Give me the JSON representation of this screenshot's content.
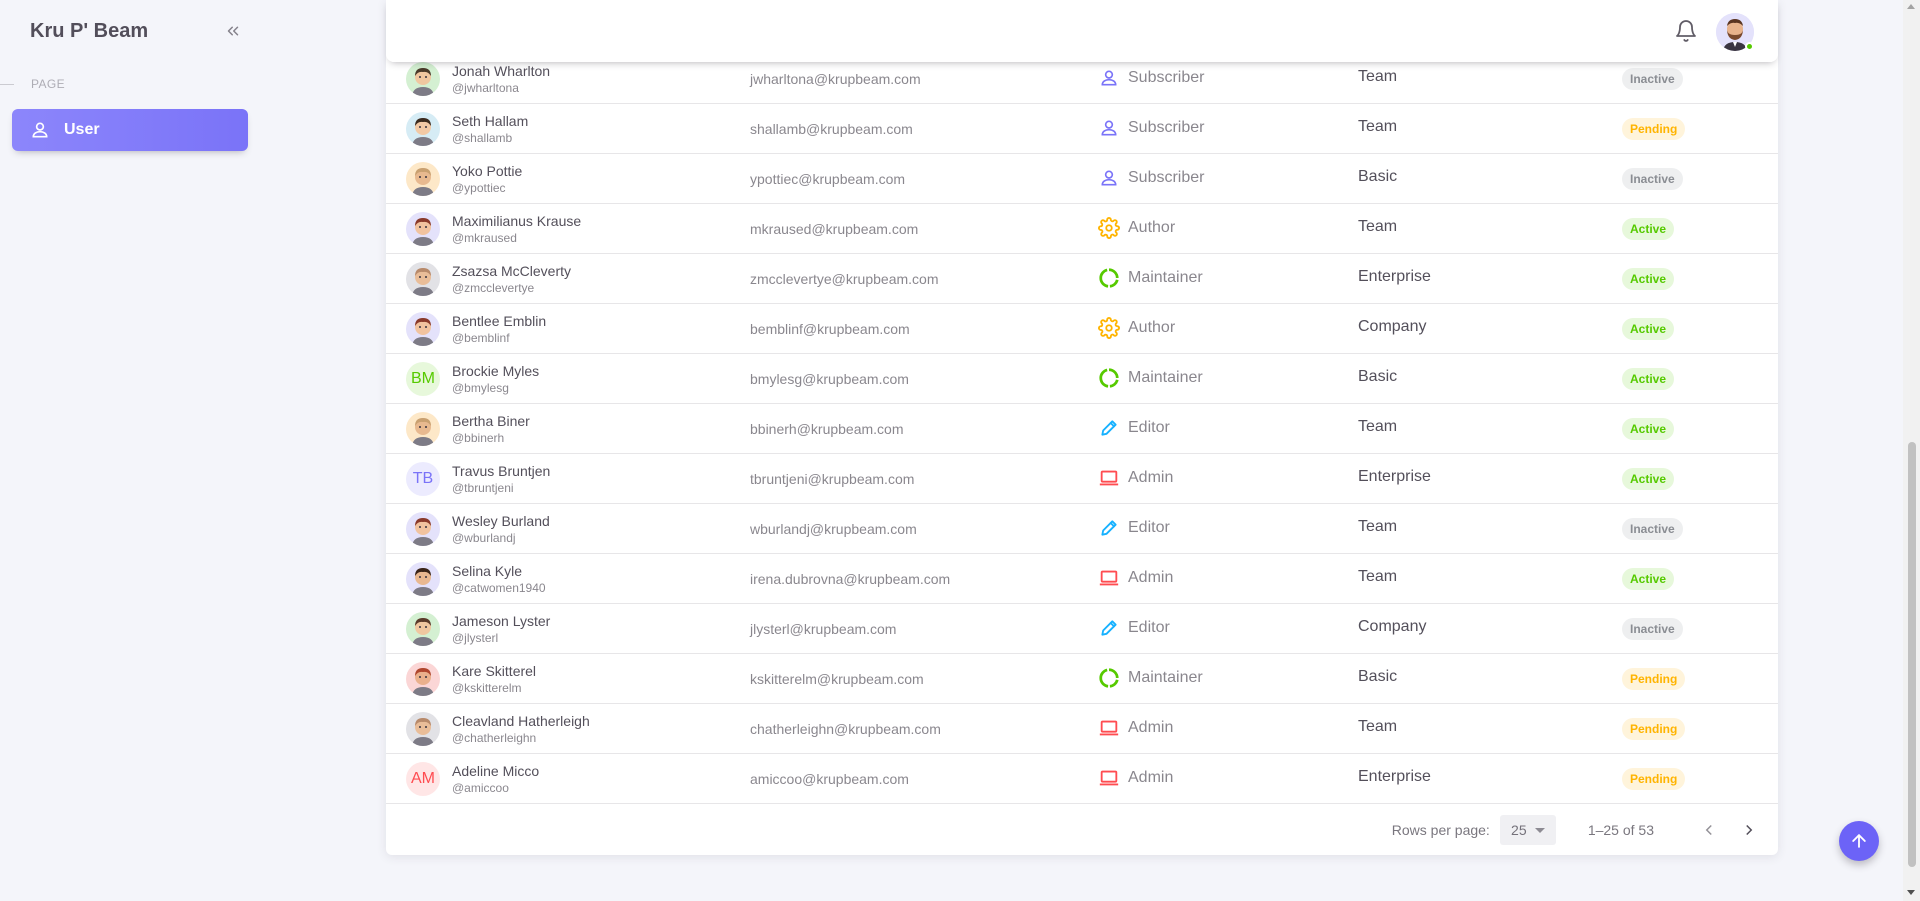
{
  "brand": "Kru P' Beam",
  "sidebar": {
    "section": "PAGE",
    "items": [
      {
        "label": "User",
        "icon": "account-outline-icon"
      }
    ]
  },
  "accent_color": "#7a73f8",
  "users": [
    {
      "name": "Jonah Wharlton",
      "handle": "@jwharltona",
      "email": "jwharltona@krupbeam.com",
      "role": "Subscriber",
      "plan": "Team",
      "status": "Inactive",
      "avatar": "image"
    },
    {
      "name": "Seth Hallam",
      "handle": "@shallamb",
      "email": "shallamb@krupbeam.com",
      "role": "Subscriber",
      "plan": "Team",
      "status": "Pending",
      "avatar": "image"
    },
    {
      "name": "Yoko Pottie",
      "handle": "@ypottiec",
      "email": "ypottiec@krupbeam.com",
      "role": "Subscriber",
      "plan": "Basic",
      "status": "Inactive",
      "avatar": "image"
    },
    {
      "name": "Maximilianus Krause",
      "handle": "@mkraused",
      "email": "mkraused@krupbeam.com",
      "role": "Author",
      "plan": "Team",
      "status": "Active",
      "avatar": "image"
    },
    {
      "name": "Zsazsa McCleverty",
      "handle": "@zmcclevertye",
      "email": "zmcclevertye@krupbeam.com",
      "role": "Maintainer",
      "plan": "Enterprise",
      "status": "Active",
      "avatar": "image"
    },
    {
      "name": "Bentlee Emblin",
      "handle": "@bemblinf",
      "email": "bemblinf@krupbeam.com",
      "role": "Author",
      "plan": "Company",
      "status": "Active",
      "avatar": "image"
    },
    {
      "name": "Brockie Myles",
      "handle": "@bmylesg",
      "email": "bmylesg@krupbeam.com",
      "role": "Maintainer",
      "plan": "Basic",
      "status": "Active",
      "avatar": "BM"
    },
    {
      "name": "Bertha Biner",
      "handle": "@bbinerh",
      "email": "bbinerh@krupbeam.com",
      "role": "Editor",
      "plan": "Team",
      "status": "Active",
      "avatar": "image"
    },
    {
      "name": "Travus Bruntjen",
      "handle": "@tbruntjeni",
      "email": "tbruntjeni@krupbeam.com",
      "role": "Admin",
      "plan": "Enterprise",
      "status": "Active",
      "avatar": "TB"
    },
    {
      "name": "Wesley Burland",
      "handle": "@wburlandj",
      "email": "wburlandj@krupbeam.com",
      "role": "Editor",
      "plan": "Team",
      "status": "Inactive",
      "avatar": "image"
    },
    {
      "name": "Selina Kyle",
      "handle": "@catwomen1940",
      "email": "irena.dubrovna@krupbeam.com",
      "role": "Admin",
      "plan": "Team",
      "status": "Active",
      "avatar": "image"
    },
    {
      "name": "Jameson Lyster",
      "handle": "@jlysterl",
      "email": "jlysterl@krupbeam.com",
      "role": "Editor",
      "plan": "Company",
      "status": "Inactive",
      "avatar": "image"
    },
    {
      "name": "Kare Skitterel",
      "handle": "@kskitterelm",
      "email": "kskitterelm@krupbeam.com",
      "role": "Maintainer",
      "plan": "Basic",
      "status": "Pending",
      "avatar": "image"
    },
    {
      "name": "Cleavland Hatherleigh",
      "handle": "@chatherleighn",
      "email": "chatherleighn@krupbeam.com",
      "role": "Admin",
      "plan": "Team",
      "status": "Pending",
      "avatar": "image"
    },
    {
      "name": "Adeline Micco",
      "handle": "@amiccoo",
      "email": "amiccoo@krupbeam.com",
      "role": "Admin",
      "plan": "Enterprise",
      "status": "Pending",
      "avatar": "AM"
    }
  ],
  "role_colors": {
    "Subscriber": "#7a73f8",
    "Author": "#ffb400",
    "Maintainer": "#56ca00",
    "Editor": "#16b1ff",
    "Admin": "#ff4c51"
  },
  "pagination": {
    "rows_per_page_label": "Rows per page:",
    "rows_per_page": "25",
    "range": "1–25 of 53"
  }
}
